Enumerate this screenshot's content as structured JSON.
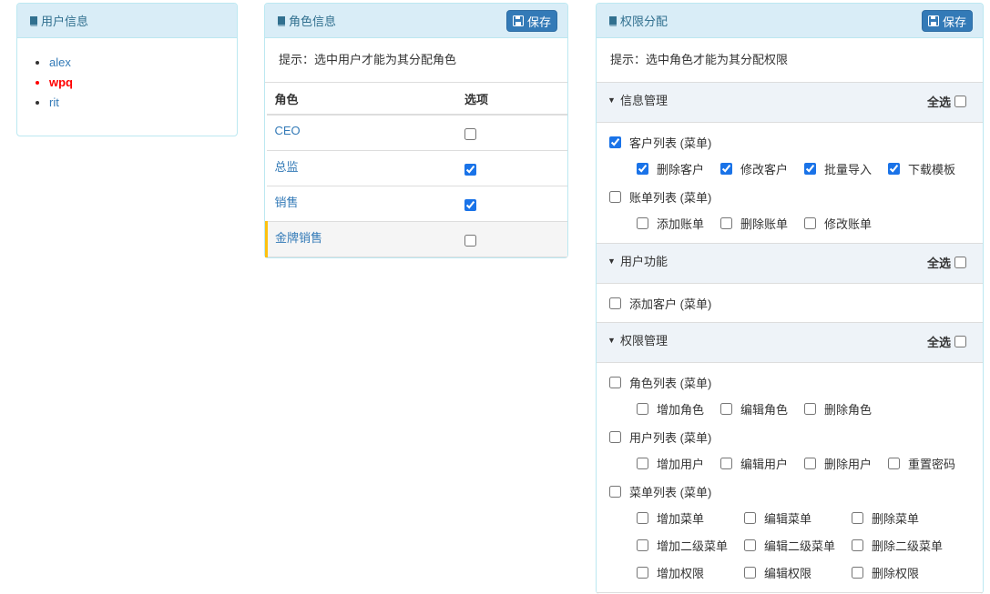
{
  "user_panel": {
    "title": "用户信息",
    "users": [
      {
        "name": "alex",
        "active": false
      },
      {
        "name": "wpq",
        "active": true
      },
      {
        "name": "rit",
        "active": false
      }
    ]
  },
  "role_panel": {
    "title": "角色信息",
    "save_label": "保存",
    "hint": "提示：选中用户才能为其分配角色",
    "columns": [
      "角色",
      "选项"
    ],
    "roles": [
      {
        "name": "CEO",
        "checked": false
      },
      {
        "name": "总监",
        "checked": true
      },
      {
        "name": "销售",
        "checked": true
      },
      {
        "name": "金牌销售",
        "checked": false
      }
    ]
  },
  "perm_panel": {
    "title": "权限分配",
    "save_label": "保存",
    "hint": "提示：选中角色才能为其分配权限",
    "select_all_label": "全选",
    "groups": [
      {
        "title": "信息管理",
        "menus": [
          {
            "label": "客户列表 (菜单)",
            "checked": true,
            "children": [
              {
                "label": "删除客户",
                "checked": true
              },
              {
                "label": "修改客户",
                "checked": true
              },
              {
                "label": "批量导入",
                "checked": true
              },
              {
                "label": "下载模板",
                "checked": true
              }
            ]
          },
          {
            "label": "账单列表 (菜单)",
            "checked": false,
            "children": [
              {
                "label": "添加账单",
                "checked": false
              },
              {
                "label": "删除账单",
                "checked": false
              },
              {
                "label": "修改账单",
                "checked": false
              }
            ]
          }
        ]
      },
      {
        "title": "用户功能",
        "menus": [
          {
            "label": "添加客户 (菜单)",
            "checked": false,
            "children": []
          }
        ]
      },
      {
        "title": "权限管理",
        "menus": [
          {
            "label": "角色列表 (菜单)",
            "checked": false,
            "children": [
              {
                "label": "增加角色",
                "checked": false
              },
              {
                "label": "编辑角色",
                "checked": false
              },
              {
                "label": "删除角色",
                "checked": false
              }
            ]
          },
          {
            "label": "用户列表 (菜单)",
            "checked": false,
            "children": [
              {
                "label": "增加用户",
                "checked": false
              },
              {
                "label": "编辑用户",
                "checked": false
              },
              {
                "label": "删除用户",
                "checked": false
              },
              {
                "label": "重置密码",
                "checked": false
              }
            ]
          },
          {
            "label": "菜单列表 (菜单)",
            "checked": false,
            "children": [
              {
                "label": "增加菜单",
                "checked": false
              },
              {
                "label": "编辑菜单",
                "checked": false
              },
              {
                "label": "删除菜单",
                "checked": false
              },
              {
                "label": "增加二级菜单",
                "checked": false
              },
              {
                "label": "编辑二级菜单",
                "checked": false
              },
              {
                "label": "删除二级菜单",
                "checked": false
              },
              {
                "label": "增加权限",
                "checked": false
              },
              {
                "label": "编辑权限",
                "checked": false
              },
              {
                "label": "删除权限",
                "checked": false
              }
            ]
          }
        ]
      }
    ]
  },
  "colors": {
    "heading_bg": "#d9edf7",
    "heading_text": "#31708f",
    "button": "#337ab7",
    "active_user": "#ff0000",
    "selected_role_marker": "#fdc00f"
  }
}
